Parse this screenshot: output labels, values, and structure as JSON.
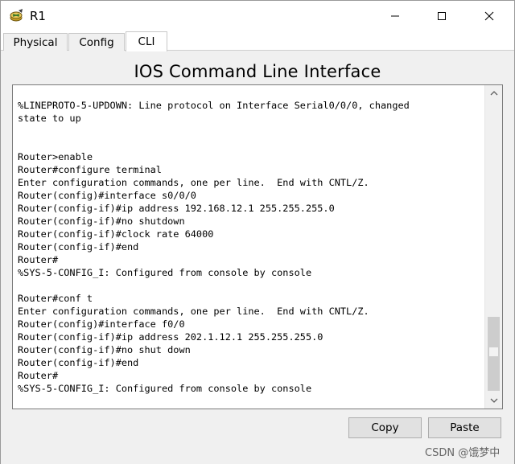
{
  "window": {
    "title": "R1",
    "app_icon": "router-icon",
    "controls": [
      "minimize-icon",
      "maximize-icon",
      "close-icon"
    ]
  },
  "tabs": [
    {
      "label": "Physical",
      "active": false
    },
    {
      "label": "Config",
      "active": false
    },
    {
      "label": "CLI",
      "active": true
    }
  ],
  "cli": {
    "heading": "IOS Command Line Interface",
    "output": "%LINEPROTO-5-UPDOWN: Line protocol on Interface Serial0/0/0, changed\nstate to up\n\n\nRouter>enable\nRouter#configure terminal\nEnter configuration commands, one per line.  End with CNTL/Z.\nRouter(config)#interface s0/0/0\nRouter(config-if)#ip address 192.168.12.1 255.255.255.0\nRouter(config-if)#no shutdown\nRouter(config-if)#clock rate 64000\nRouter(config-if)#end\nRouter#\n%SYS-5-CONFIG_I: Configured from console by console\n\nRouter#conf t\nEnter configuration commands, one per line.  End with CNTL/Z.\nRouter(config)#interface f0/0\nRouter(config-if)#ip address 202.1.12.1 255.255.255.0\nRouter(config-if)#no shut down\nRouter(config-if)#end\nRouter#\n%SYS-5-CONFIG_I: Configured from console by console"
  },
  "buttons": {
    "copy": "Copy",
    "paste": "Paste"
  },
  "watermark": "CSDN @饿梦中",
  "colors": {
    "panel": "#f0f0f0",
    "terminal_bg": "#ffffff",
    "button_bg": "#e1e1e1",
    "scroll_thumb": "#cdcdcd"
  }
}
